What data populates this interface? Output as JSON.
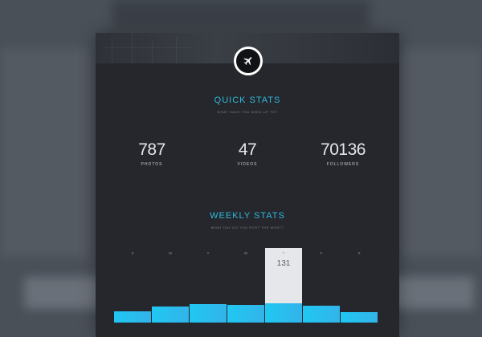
{
  "quick_stats": {
    "title": "QUICK STATS",
    "subtitle": "WHAT HAVE YOU BEEN UP TO?",
    "items": [
      {
        "value": "787",
        "label": "PHOTOS"
      },
      {
        "value": "47",
        "label": "VIDEOS"
      },
      {
        "value": "70136",
        "label": "FOLLOWERS"
      }
    ]
  },
  "weekly_stats": {
    "title": "WEEKLY STATS",
    "subtitle": "WHAT DAY DO YOU POST THE MOST?",
    "highlight_value": "131"
  },
  "logo": {
    "icon": "airplane-icon"
  },
  "colors": {
    "accent": "#2fb9d8",
    "bar": "#1fc8f2",
    "card": "#25272d",
    "highlight": "#e6e7ea"
  },
  "chart_data": {
    "type": "bar",
    "categories": [
      "S",
      "M",
      "T",
      "W",
      "T",
      "F",
      "S"
    ],
    "values": [
      17,
      25,
      29,
      28,
      30,
      26,
      16
    ],
    "highlighted_index": 4,
    "highlighted_label": "131"
  }
}
